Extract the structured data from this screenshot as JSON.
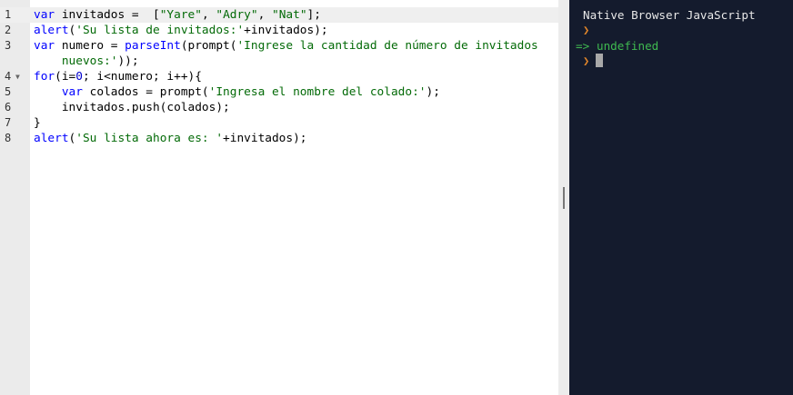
{
  "editor": {
    "lines": [
      {
        "num": "1",
        "parts": [
          {
            "t": "var",
            "c": "kw"
          },
          {
            "t": " invitados =  ["
          },
          {
            "t": "\"Yare\"",
            "c": "str"
          },
          {
            "t": ", "
          },
          {
            "t": "\"Adry\"",
            "c": "str"
          },
          {
            "t": ", "
          },
          {
            "t": "\"Nat\"",
            "c": "str"
          },
          {
            "t": "];"
          }
        ]
      },
      {
        "num": "2",
        "parts": [
          {
            "t": "alert",
            "c": "fn"
          },
          {
            "t": "("
          },
          {
            "t": "'Su lista de invitados:'",
            "c": "str"
          },
          {
            "t": "+invitados);"
          }
        ]
      },
      {
        "num": "3",
        "parts": [
          {
            "t": "var",
            "c": "kw"
          },
          {
            "t": " numero = "
          },
          {
            "t": "parseInt",
            "c": "fn"
          },
          {
            "t": "(prompt("
          },
          {
            "t": "'Ingrese la cantidad de número de invitados",
            "c": "str"
          }
        ]
      },
      {
        "num": "",
        "parts": [
          {
            "t": "    "
          },
          {
            "t": "nuevos:'",
            "c": "str"
          },
          {
            "t": "));"
          }
        ]
      },
      {
        "num": "4",
        "fold": "▼",
        "parts": [
          {
            "t": "for",
            "c": "kw"
          },
          {
            "t": "(i="
          },
          {
            "t": "0",
            "c": "num"
          },
          {
            "t": "; i<numero; i++){"
          }
        ]
      },
      {
        "num": "5",
        "parts": [
          {
            "t": "    "
          },
          {
            "t": "var",
            "c": "kw"
          },
          {
            "t": " colados = prompt("
          },
          {
            "t": "'Ingresa el nombre del colado:'",
            "c": "str"
          },
          {
            "t": ");"
          }
        ]
      },
      {
        "num": "6",
        "parts": [
          {
            "t": "    invitados.push(colados);"
          }
        ]
      },
      {
        "num": "7",
        "parts": [
          {
            "t": "}"
          }
        ]
      },
      {
        "num": "8",
        "parts": [
          {
            "t": "alert",
            "c": "fn"
          },
          {
            "t": "("
          },
          {
            "t": "'Su lista ahora es: '",
            "c": "str"
          },
          {
            "t": "+invitados);"
          }
        ]
      }
    ]
  },
  "console": {
    "title": "Native Browser JavaScript",
    "prompt_glyph": "❯",
    "result_arrow": "=>",
    "result_value": "undefined"
  }
}
